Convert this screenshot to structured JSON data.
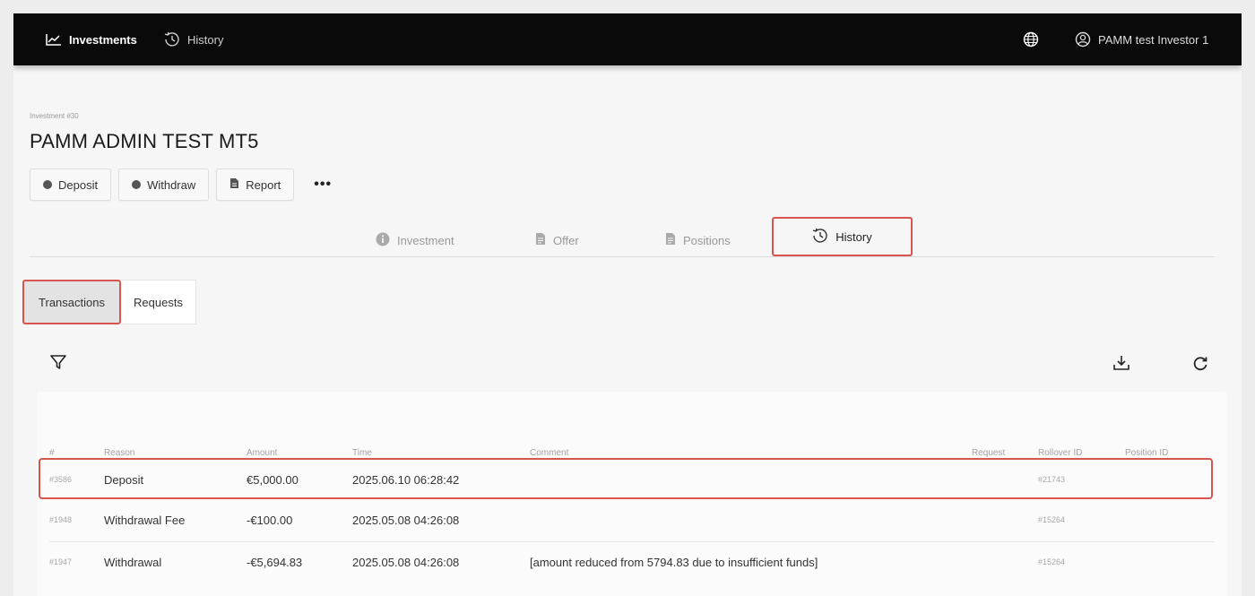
{
  "nav": {
    "investments_label": "Investments",
    "history_label": "History",
    "user_label": "PAMM test Investor 1"
  },
  "investment": {
    "label": "Investment #30",
    "title": "PAMM ADMIN TEST MT5"
  },
  "actions": {
    "deposit": "Deposit",
    "withdraw": "Withdraw",
    "report": "Report",
    "more": "•••"
  },
  "tabs": {
    "investment": "Investment",
    "offer": "Offer",
    "positions": "Positions",
    "history": "History"
  },
  "subtabs": {
    "transactions": "Transactions",
    "requests": "Requests"
  },
  "table": {
    "columns": [
      "#",
      "Reason",
      "Amount",
      "Time",
      "Comment",
      "Request",
      "Rollover ID",
      "Position ID"
    ],
    "rows": [
      {
        "id": "#3586",
        "reason": "Deposit",
        "amount": "€5,000.00",
        "time": "2025.06.10 06:28:42",
        "comment": "",
        "request": "",
        "rollover": "#21743",
        "position": ""
      },
      {
        "id": "#1948",
        "reason": "Withdrawal Fee",
        "amount": "-€100.00",
        "time": "2025.05.08 04:26:08",
        "comment": "",
        "request": "",
        "rollover": "#15264",
        "position": ""
      },
      {
        "id": "#1947",
        "reason": "Withdrawal",
        "amount": "-€5,694.83",
        "time": "2025.05.08 04:26:08",
        "comment": "[amount reduced from 5794.83 due to insufficient funds]",
        "request": "",
        "rollover": "#15264",
        "position": ""
      }
    ]
  },
  "colors": {
    "highlight": "#d9534f",
    "nav_bg": "#0a0a0a"
  }
}
